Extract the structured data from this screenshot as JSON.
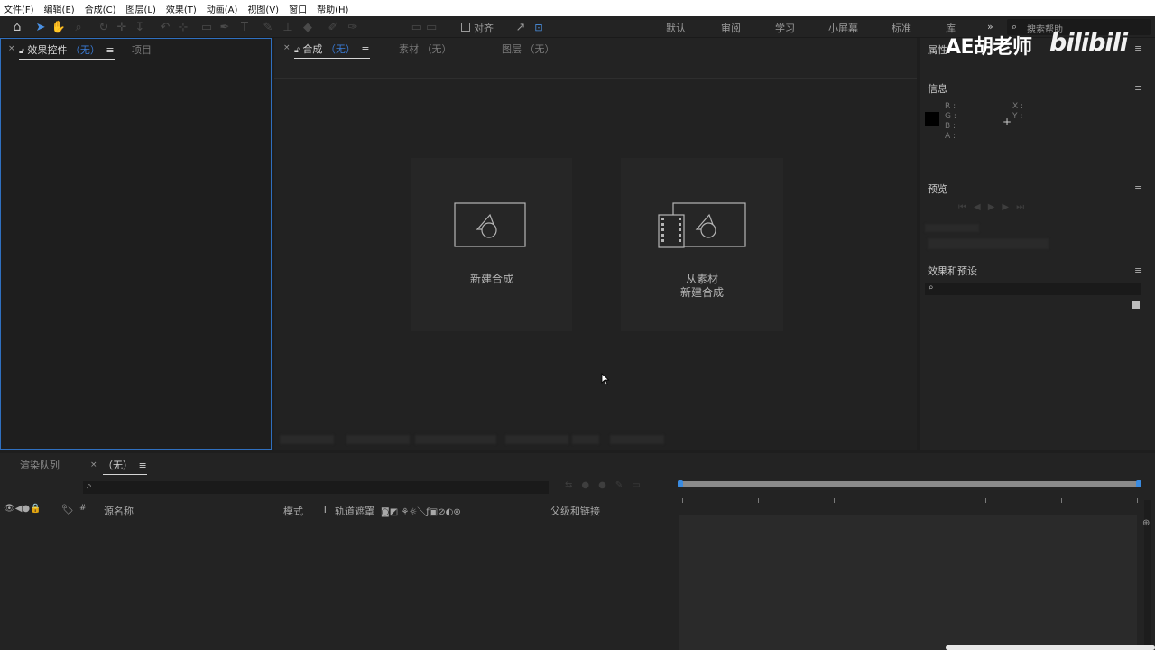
{
  "menu": [
    "文件(F)",
    "编辑(E)",
    "合成(C)",
    "图层(L)",
    "效果(T)",
    "动画(A)",
    "视图(V)",
    "窗口",
    "帮助(H)"
  ],
  "toolbar": {
    "snap_label": "对齐",
    "workspaces": [
      "默认",
      "审阅",
      "学习",
      "小屏幕",
      "标准",
      "库"
    ],
    "more": "»",
    "search_placeholder": "搜索帮助"
  },
  "effects_panel": {
    "tab_label": "效果控件",
    "tab_none": "（无）",
    "project_tab": "项目"
  },
  "comp_panel": {
    "tab_label": "合成",
    "tab_none": "（无）",
    "footage_tab": "素材 （无）",
    "layer_tab": "图层 （无）",
    "new_comp": "新建合成",
    "from_footage_1": "从素材",
    "from_footage_2": "新建合成"
  },
  "right": {
    "properties_title": "属性",
    "info_title": "信息",
    "info_r": "R :",
    "info_g": "G :",
    "info_b": "B :",
    "info_a": "A :",
    "info_x": "X :",
    "info_y": "Y :",
    "preview_title": "预览",
    "effects_title": "效果和预设"
  },
  "overlay": {
    "author": "AE胡老师",
    "site": "bilibili"
  },
  "timeline": {
    "render_tab": "渲染队列",
    "comp_tab": "（无）",
    "col_source": "源名称",
    "col_mode": "模式",
    "col_t": "T",
    "col_matte": "轨道遮罩",
    "col_parent": "父级和链接",
    "col_hash": "#"
  }
}
